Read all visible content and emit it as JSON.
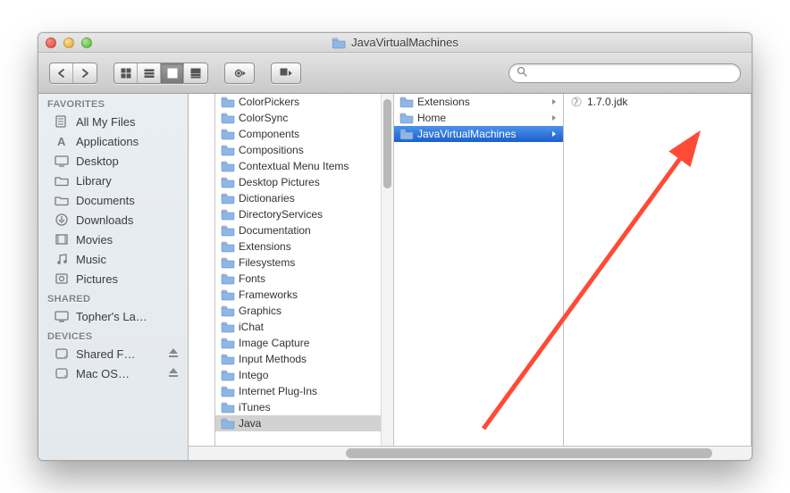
{
  "window": {
    "title": "JavaVirtualMachines"
  },
  "toolbar": {
    "search_placeholder": ""
  },
  "sidebar": {
    "sections": [
      {
        "header": "FAVORITES",
        "items": [
          {
            "icon": "all-files",
            "label": "All My Files"
          },
          {
            "icon": "apps",
            "label": "Applications"
          },
          {
            "icon": "desktop",
            "label": "Desktop"
          },
          {
            "icon": "folder",
            "label": "Library"
          },
          {
            "icon": "folder",
            "label": "Documents"
          },
          {
            "icon": "downloads",
            "label": "Downloads"
          },
          {
            "icon": "movies",
            "label": "Movies"
          },
          {
            "icon": "music",
            "label": "Music"
          },
          {
            "icon": "pictures",
            "label": "Pictures"
          }
        ]
      },
      {
        "header": "SHARED",
        "items": [
          {
            "icon": "computer",
            "label": "Topher's La…"
          }
        ]
      },
      {
        "header": "DEVICES",
        "items": [
          {
            "icon": "disk",
            "label": "Shared F…",
            "eject": true
          },
          {
            "icon": "disk",
            "label": "Mac OS…",
            "eject": true
          }
        ]
      }
    ]
  },
  "columns": {
    "col1": [
      {
        "label": "ColorPickers",
        "folder": true,
        "arrow": true
      },
      {
        "label": "ColorSync",
        "folder": true,
        "arrow": true
      },
      {
        "label": "Components",
        "folder": true,
        "arrow": true
      },
      {
        "label": "Compositions",
        "folder": true,
        "arrow": true
      },
      {
        "label": "Contextual Menu Items",
        "folder": true,
        "arrow": true
      },
      {
        "label": "Desktop Pictures",
        "folder": true,
        "arrow": true
      },
      {
        "label": "Dictionaries",
        "folder": true,
        "arrow": true
      },
      {
        "label": "DirectoryServices",
        "folder": true,
        "arrow": true
      },
      {
        "label": "Documentation",
        "folder": true,
        "arrow": true
      },
      {
        "label": "Extensions",
        "folder": true,
        "arrow": true
      },
      {
        "label": "Filesystems",
        "folder": true,
        "arrow": true
      },
      {
        "label": "Fonts",
        "folder": true,
        "arrow": true
      },
      {
        "label": "Frameworks",
        "folder": true,
        "arrow": true
      },
      {
        "label": "Graphics",
        "folder": true,
        "arrow": true
      },
      {
        "label": "iChat",
        "folder": true,
        "arrow": true
      },
      {
        "label": "Image Capture",
        "folder": true,
        "arrow": true
      },
      {
        "label": "Input Methods",
        "folder": true,
        "arrow": true
      },
      {
        "label": "Intego",
        "folder": true,
        "arrow": true
      },
      {
        "label": "Internet Plug-Ins",
        "folder": true,
        "arrow": true
      },
      {
        "label": "iTunes",
        "folder": true,
        "arrow": true
      },
      {
        "label": "Java",
        "folder": true,
        "arrow": true,
        "selected": "inactive"
      }
    ],
    "col2": [
      {
        "label": "Extensions",
        "folder": true,
        "arrow": true
      },
      {
        "label": "Home",
        "folder": true,
        "arrow": true
      },
      {
        "label": "JavaVirtualMachines",
        "folder": true,
        "arrow": true,
        "selected": "active"
      }
    ],
    "col3": [
      {
        "label": "1.7.0.jdk",
        "file": true
      }
    ]
  }
}
